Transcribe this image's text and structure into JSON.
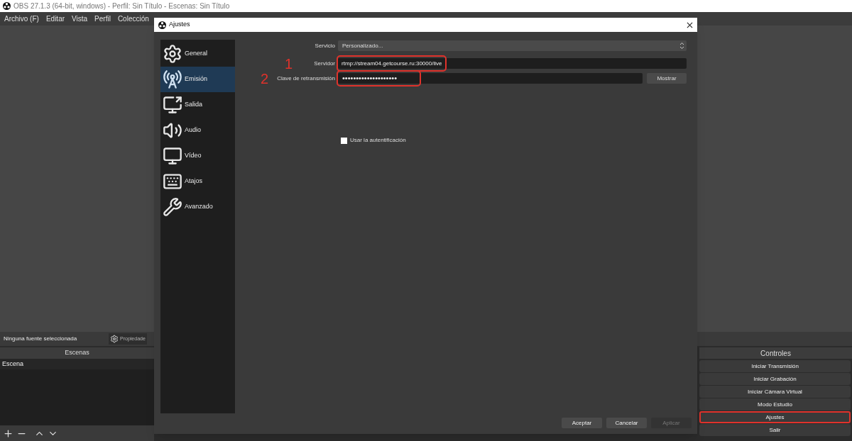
{
  "app_window": {
    "title": "OBS 27.1.3 (64-bit, windows) - Perfil: Sin Título - Escenas: Sin Título",
    "menu": [
      "Archivo (F)",
      "Editar",
      "Vista",
      "Perfil",
      "Colección"
    ]
  },
  "source_toolbar": {
    "status": "Ninguna fuente seleccionada",
    "properties_button": "Propiedade"
  },
  "scenes": {
    "title": "Escenas",
    "items": [
      "Escena"
    ]
  },
  "controls": {
    "title": "Controles",
    "buttons": [
      {
        "label": "Iniciar Transmisión",
        "highlighted": false
      },
      {
        "label": "Iniciar Grabación",
        "highlighted": false
      },
      {
        "label": "Iniciar Cámara Virtual",
        "highlighted": false
      },
      {
        "label": "Modo Estudio",
        "highlighted": false
      },
      {
        "label": "Ajustes",
        "highlighted": true
      },
      {
        "label": "Salir",
        "highlighted": false
      }
    ]
  },
  "dialog": {
    "title": "Ajustes",
    "sections": [
      {
        "label": "General",
        "kind": "gear",
        "selected": false
      },
      {
        "label": "Emisión",
        "kind": "antenna",
        "selected": true
      },
      {
        "label": "Salida",
        "kind": "output",
        "selected": false
      },
      {
        "label": "Audio",
        "kind": "speaker",
        "selected": false
      },
      {
        "label": "Vídeo",
        "kind": "monitor",
        "selected": false
      },
      {
        "label": "Atajos",
        "kind": "keyboard",
        "selected": false
      },
      {
        "label": "Avanzado",
        "kind": "tools",
        "selected": false
      }
    ],
    "service": {
      "label": "Servicio",
      "value": "Personalizado..."
    },
    "server": {
      "label": "Servidor",
      "value": "rtmp://stream04.getcourse.ru:30000/live",
      "highlighted": true,
      "annotation": "1"
    },
    "stream_key": {
      "label": "Clave de retransmisión",
      "value": "••••••••••••••••••••",
      "highlighted": true,
      "annotation": "2",
      "button": "Mostrar"
    },
    "auth_checkbox": {
      "label": "Usar la autentificación",
      "checked": false
    },
    "buttons": [
      {
        "label": "Aceptar",
        "disabled": false
      },
      {
        "label": "Cancelar",
        "disabled": false
      },
      {
        "label": "Aplicar",
        "disabled": true
      }
    ]
  }
}
